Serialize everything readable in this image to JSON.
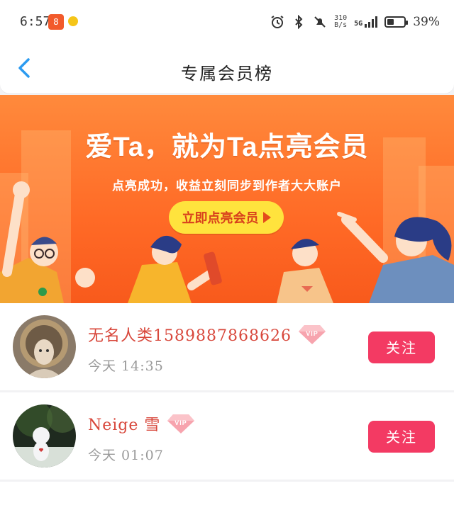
{
  "status_bar": {
    "time": "6:57",
    "app_icon_text": "8",
    "net_speed": "310",
    "net_unit": "B/s",
    "signal_label": "5G",
    "battery": "39%",
    "battery_level": 0.39
  },
  "header": {
    "title": "专属会员榜"
  },
  "banner": {
    "headline": "爱Ta，就为Ta点亮会员",
    "subtext": "点亮成功，收益立刻同步到作者大大账户",
    "cta_label": "立即点亮会员"
  },
  "members": [
    {
      "name": "无名人类1589887868626",
      "badge": "VIP",
      "time": "今天 14:35",
      "follow_label": "关注"
    },
    {
      "name": "Neige 雪",
      "badge": "VIP",
      "time": "今天 01:07",
      "follow_label": "关注"
    }
  ],
  "colors": {
    "accent": "#f33a63",
    "name_color": "#d8473b",
    "back_blue": "#2c9bf0",
    "banner_orange": "#ff6a26",
    "cta_yellow": "#ffe33d"
  }
}
